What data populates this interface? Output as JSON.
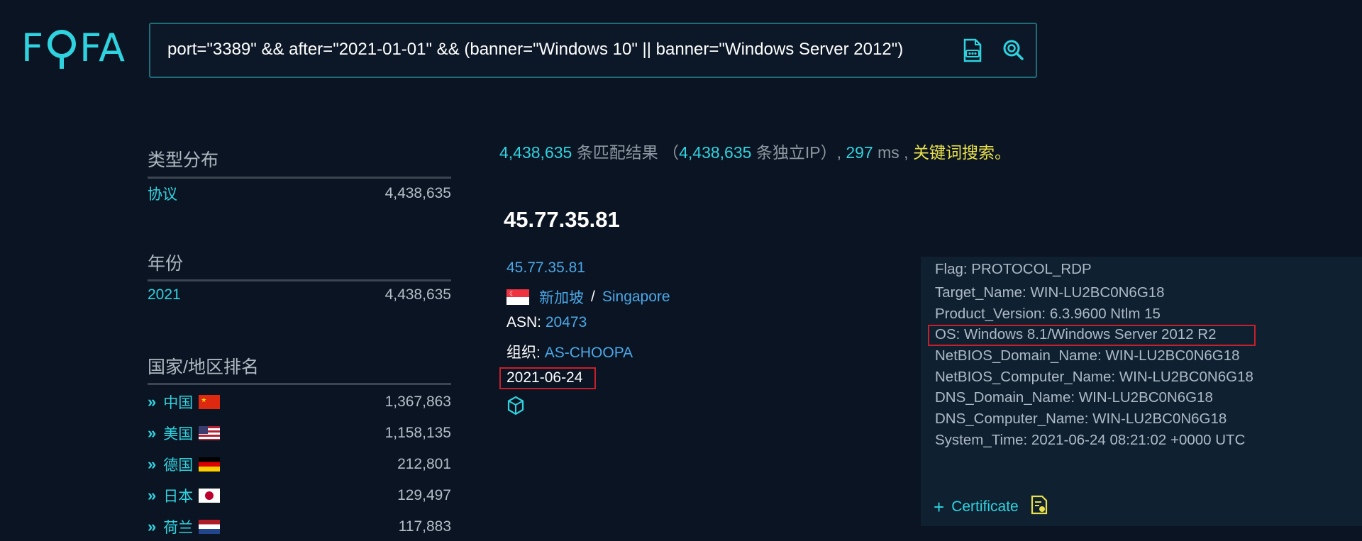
{
  "header": {
    "logo_left": "F",
    "logo_right": "FA",
    "query": "port=\"3389\" && after=\"2021-01-01\" && (banner=\"Windows 10\" || banner=\"Windows Server 2012\")"
  },
  "sidebar": {
    "type_title": "类型分布",
    "type_rows": [
      {
        "label": "协议",
        "count": "4,438,635"
      }
    ],
    "year_title": "年份",
    "year_rows": [
      {
        "label": "2021",
        "count": "4,438,635"
      }
    ],
    "country_title": "国家/地区排名",
    "country_rows": [
      {
        "label": "中国",
        "count": "1,367,863",
        "flag": "cn"
      },
      {
        "label": "美国",
        "count": "1,158,135",
        "flag": "us"
      },
      {
        "label": "德国",
        "count": "212,801",
        "flag": "de"
      },
      {
        "label": "日本",
        "count": "129,497",
        "flag": "jp"
      },
      {
        "label": "荷兰",
        "count": "117,883",
        "flag": "nl"
      }
    ]
  },
  "summary": {
    "results": "4,438,635",
    "results_text": "条匹配结果",
    "open_paren": "（",
    "unique_ip": "4,438,635",
    "unique_text": "条独立IP",
    "close_paren": "）,",
    "time": "297",
    "time_unit": "ms ,",
    "keyword": "关键词搜索",
    "period": "。"
  },
  "result": {
    "ip_title": "45.77.35.81",
    "ip_link": "45.77.35.81",
    "country_cn": "新加坡",
    "separator": "/",
    "country_en": "Singapore",
    "asn_label": "ASN:",
    "asn_value": "20473",
    "org_label": "组织:",
    "org_value": "AS-CHOOPA",
    "date": "2021-06-24"
  },
  "banner": {
    "lines": [
      "Flag: PROTOCOL_RDP",
      "Target_Name: WIN-LU2BC0N6G18",
      "Product_Version: 6.3.9600 Ntlm 15",
      "OS: Windows 8.1/Windows Server 2012 R2",
      "NetBIOS_Domain_Name: WIN-LU2BC0N6G18",
      "NetBIOS_Computer_Name: WIN-LU2BC0N6G18",
      "DNS_Domain_Name: WIN-LU2BC0N6G18",
      "DNS_Computer_Name: WIN-LU2BC0N6G18",
      "System_Time: 2021-06-24 08:21:02 +0000 UTC"
    ],
    "certificate": "Certificate"
  },
  "colors": {
    "accent": "#2fd3e0",
    "link": "#4aa8e8",
    "keyword": "#e8e04a",
    "highlight": "#c8202a",
    "background": "#0b1422"
  },
  "icons": {
    "logo_pin": "location-pin-icon",
    "export": "file-export-icon",
    "search": "search-icon",
    "product": "cube-icon",
    "certificate": "certificate-icon",
    "expand": "chevron-double-right-icon"
  }
}
